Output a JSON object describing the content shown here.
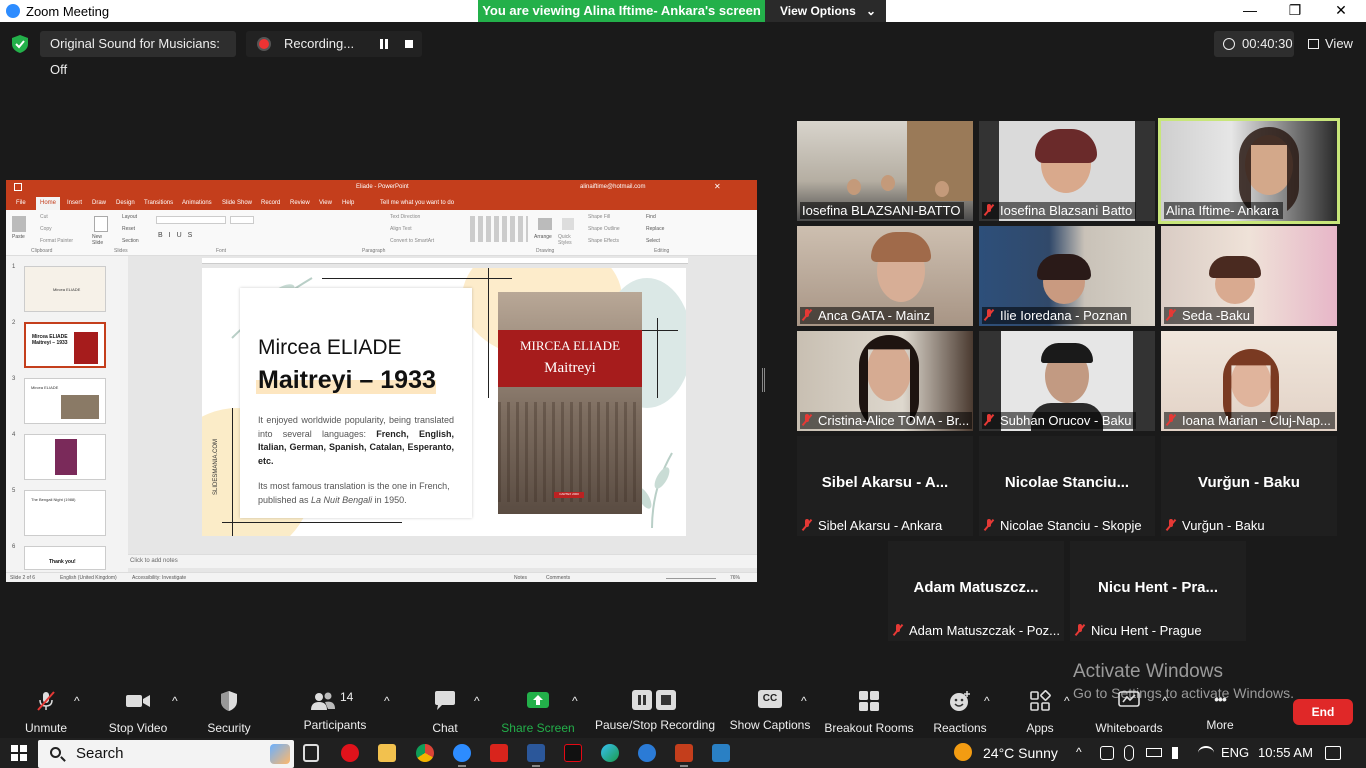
{
  "window": {
    "title": "Zoom Meeting",
    "minimize": "—",
    "maximize": "❐",
    "close": "✕"
  },
  "banner": {
    "text": "You are viewing Alina Iftime- Ankara's screen",
    "view_options": "View Options",
    "caret": "⌄"
  },
  "topbar": {
    "original_sound": "Original Sound for Musicians: Off",
    "recording": "Recording...",
    "timer": "00:40:30",
    "view": "View"
  },
  "powerpoint": {
    "doc_title": "Eliade - PowerPoint",
    "account": "alinaiftime@hotmail.com",
    "tabs": [
      "File",
      "Home",
      "Insert",
      "Draw",
      "Design",
      "Transitions",
      "Animations",
      "Slide Show",
      "Record",
      "Review",
      "View",
      "Help"
    ],
    "tell_me": "Tell me what you want to do",
    "ribbon_groups": [
      "Clipboard",
      "Slides",
      "Font",
      "Paragraph",
      "Drawing",
      "Editing"
    ],
    "ribbon_buttons": {
      "paste": "Paste",
      "cut": "Cut",
      "copy": "Copy",
      "format_painter": "Format Painter",
      "new_slide": "New Slide",
      "layout": "Layout",
      "reset": "Reset",
      "section": "Section",
      "text_direction": "Text Direction",
      "align_text": "Align Text",
      "convert_smartart": "Convert to SmartArt",
      "arrange": "Arrange",
      "quick_styles": "Quick Styles",
      "shape_fill": "Shape Fill",
      "shape_outline": "Shape Outline",
      "shape_effects": "Shape Effects",
      "find": "Find",
      "replace": "Replace",
      "select": "Select"
    },
    "thumbnails": [
      {
        "num": "1",
        "text": "Mircea ELIADE"
      },
      {
        "num": "2",
        "text": "Mircea ELIADE Maitreyi – 1933"
      },
      {
        "num": "3",
        "text": "Mircea ELIADE"
      },
      {
        "num": "4",
        "text": ""
      },
      {
        "num": "5",
        "text": "The Bengali Night (1988)"
      },
      {
        "num": "6",
        "text": "Thank you!"
      }
    ],
    "slide": {
      "author": "Mircea ELIADE",
      "book": "Maitreyi – 1933",
      "p1_start": "It enjoyed worldwide popularity, being translated into several languages: ",
      "p1_langs": "French, English, Italian, German, Spanish, Catalan, Esperanto, etc.",
      "p2_start": "Its most famous translation is the one in French, published as ",
      "p2_title": "La Nuit Bengali",
      "p2_end": " in 1950.",
      "side_text": "SLIDESMANIA.COM",
      "cover_author": "MIRCEA ELIADE",
      "cover_title": "Maitreyi",
      "cover_publisher": "CARTEX 2000"
    },
    "notes": "Click to add notes",
    "status": {
      "slide": "Slide 2 of 6",
      "language": "English (United Kingdom)",
      "accessibility": "Accessibility: Investigate",
      "notes": "Notes",
      "comments": "Comments",
      "zoom": "76%"
    }
  },
  "gallery": [
    {
      "name": "Iosefina BLAZSANI-BATTO",
      "muted": false,
      "video": true
    },
    {
      "name": "Iosefina Blazsani Batto",
      "muted": true,
      "video": true
    },
    {
      "name": "Alina Iftime- Ankara",
      "muted": false,
      "video": true,
      "active": true
    },
    {
      "name": "Anca GATA - Mainz",
      "muted": true,
      "video": true
    },
    {
      "name": "Ilie Ioredana - Poznan",
      "muted": true,
      "video": true
    },
    {
      "name": "Seda -Baku",
      "muted": true,
      "video": true
    },
    {
      "name": "Cristina-Alice TOMA - Br...",
      "muted": true,
      "video": true
    },
    {
      "name": "Subhan Orucov - Baku",
      "muted": true,
      "video": true
    },
    {
      "name": "Ioana Marian - Cluj-Nap...",
      "muted": true,
      "video": true
    },
    {
      "name": "Sibel Akarsu - Ankara",
      "big": "Sibel Akarsu - A...",
      "muted": true,
      "video": false
    },
    {
      "name": "Nicolae Stanciu - Skopje",
      "big": "Nicolae Stanciu...",
      "muted": true,
      "video": false
    },
    {
      "name": "Vurğun - Baku",
      "big": "Vurğun - Baku",
      "muted": true,
      "video": false
    },
    {
      "name": "Adam Matuszczak - Poz...",
      "big": "Adam Matuszcz...",
      "muted": true,
      "video": false
    },
    {
      "name": "Nicu Hent - Prague",
      "big": "Nicu Hent - Pra...",
      "muted": true,
      "video": false
    }
  ],
  "watermark": {
    "line1": "Activate Windows",
    "line2": "Go to Settings to activate Windows."
  },
  "toolbar": {
    "unmute": "Unmute",
    "stop_video": "Stop Video",
    "security": "Security",
    "participants": "Participants",
    "participants_count": "14",
    "chat": "Chat",
    "share_screen": "Share Screen",
    "pause_stop_recording": "Pause/Stop Recording",
    "show_captions": "Show Captions",
    "captions_icon": "CC",
    "breakout_rooms": "Breakout Rooms",
    "reactions": "Reactions",
    "apps": "Apps",
    "whiteboards": "Whiteboards",
    "more": "More",
    "more_icon": "•••",
    "end": "End",
    "caret": "^"
  },
  "taskbar": {
    "search": "Search",
    "weather": "24°C  Sunny",
    "language": "ENG",
    "time": "10:55 AM"
  },
  "colors": {
    "share_green": "#23b04a",
    "end_red": "#e02828",
    "ppt_red": "#c43e1c",
    "active_border": "#c8e67a"
  }
}
